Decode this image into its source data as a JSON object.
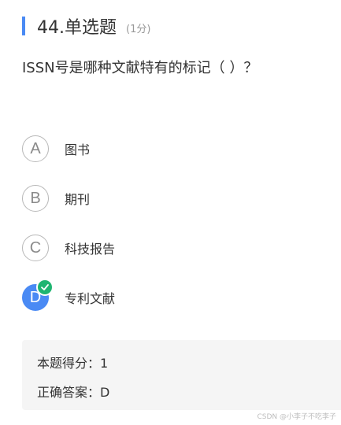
{
  "question": {
    "number_type": "44.单选题",
    "score": "(1分)",
    "stem": "ISSN号是哪种文献特有的标记（ ）？",
    "accent_color": "#4a8af4"
  },
  "options": [
    {
      "letter": "A",
      "text": "图书",
      "selected": false
    },
    {
      "letter": "B",
      "text": "期刊",
      "selected": false
    },
    {
      "letter": "C",
      "text": "科技报告",
      "selected": false
    },
    {
      "letter": "D",
      "text": "专利文献",
      "selected": true,
      "badge_icon": "check-icon",
      "badge_color": "#1fb571"
    }
  ],
  "result": {
    "score_text": "本题得分：1",
    "answer_text": "正确答案：D"
  },
  "watermark": "CSDN @小李子不吃李子"
}
